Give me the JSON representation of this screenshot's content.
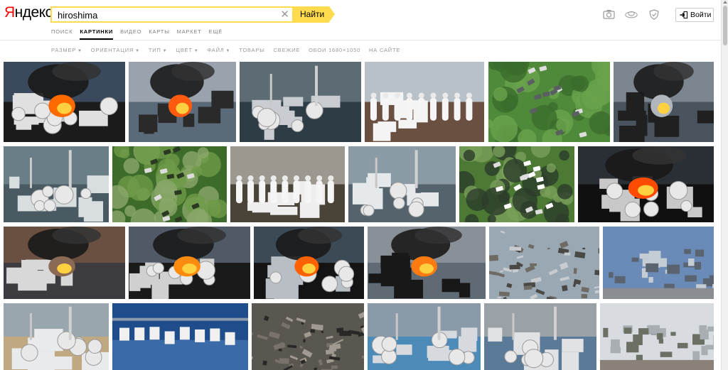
{
  "brand": {
    "logo_first": "Я",
    "logo_rest": "ндекс"
  },
  "search": {
    "query": "hiroshima",
    "button_label": "Найти"
  },
  "services": [
    {
      "label": "ПОИСК",
      "active": false
    },
    {
      "label": "КАРТИНКИ",
      "active": true
    },
    {
      "label": "ВИДЕО",
      "active": false
    },
    {
      "label": "КАРТЫ",
      "active": false
    },
    {
      "label": "МАРКЕТ",
      "active": false
    },
    {
      "label": "ЕЩЁ",
      "active": false
    }
  ],
  "filters": [
    {
      "label": "РАЗМЕР",
      "dropdown": true
    },
    {
      "label": "ОРИЕНТАЦИЯ",
      "dropdown": true
    },
    {
      "label": "ТИП",
      "dropdown": true
    },
    {
      "label": "ЦВЕТ",
      "dropdown": true
    },
    {
      "label": "ФАЙЛ",
      "dropdown": true
    },
    {
      "label": "ТОВАРЫ",
      "dropdown": false
    },
    {
      "label": "СВЕЖИЕ",
      "dropdown": false
    },
    {
      "label": "ОБОИ 1680×1050",
      "dropdown": false
    },
    {
      "label": "НА САЙТЕ",
      "dropdown": false
    }
  ],
  "header_icons": [
    "camera-icon",
    "cloud-disk-icon",
    "shield-icon"
  ],
  "login": {
    "label": "Войти",
    "icon": "login-arrow-icon"
  },
  "colors": {
    "accent": "#ffdb4d",
    "logo_red": "#ff0000"
  },
  "results": [
    {
      "subject": "fire",
      "palette": [
        "#3a4a5c",
        "#e0e0e0",
        "#ff6a00",
        "#1b1b1b"
      ]
    },
    {
      "subject": "smoke",
      "palette": [
        "#9aa3ad",
        "#2a2a2a",
        "#ff5a10",
        "#5a6a78"
      ]
    },
    {
      "subject": "plant",
      "palette": [
        "#5c6b74",
        "#c9ccd0",
        "#ffffff",
        "#2e3c46"
      ]
    },
    {
      "subject": "suits",
      "palette": [
        "#b8c0c8",
        "#f4f4f4",
        "#888f96",
        "#6a5040"
      ]
    },
    {
      "subject": "green",
      "palette": [
        "#4f8a3a",
        "#6aa24c",
        "#5a5f62",
        "#3b6b2c"
      ]
    },
    {
      "subject": "smoke",
      "palette": [
        "#7c8690",
        "#202020",
        "#b0b6bc",
        "#4a545e"
      ]
    },
    {
      "subject": "plant",
      "palette": [
        "#6a7e88",
        "#d8dde0",
        "#8a9aa4",
        "#4a5a62"
      ]
    },
    {
      "subject": "green",
      "palette": [
        "#3d6b2a",
        "#6e9a48",
        "#2a3a22",
        "#8aa86a"
      ]
    },
    {
      "subject": "suits",
      "palette": [
        "#9c9890",
        "#eeeeee",
        "#6e6456",
        "#4a4438"
      ]
    },
    {
      "subject": "plant",
      "palette": [
        "#8a9ba6",
        "#e6e9eb",
        "#a9b6be",
        "#55646c"
      ]
    },
    {
      "subject": "green",
      "palette": [
        "#4c7a34",
        "#2c3c2a",
        "#ffffff",
        "#7aa05a"
      ]
    },
    {
      "subject": "fire",
      "palette": [
        "#2a2f35",
        "#c8c8c8",
        "#ff4a00",
        "#101010"
      ]
    },
    {
      "subject": "smoke",
      "palette": [
        "#6a5040",
        "#d8d8d8",
        "#8a6a54",
        "#3c3c40"
      ]
    },
    {
      "subject": "fire",
      "palette": [
        "#505a66",
        "#d0d0d0",
        "#ff8a10",
        "#1a1a1a"
      ]
    },
    {
      "subject": "fire",
      "palette": [
        "#3c4a56",
        "#b8bec4",
        "#ff6000",
        "#141414"
      ]
    },
    {
      "subject": "smoke",
      "palette": [
        "#8a9098",
        "#181818",
        "#ff7a10",
        "#606a74"
      ]
    },
    {
      "subject": "debris",
      "palette": [
        "#9aa8b4",
        "#6e6a64",
        "#c8ccd0",
        "#4a4844"
      ]
    },
    {
      "subject": "city",
      "palette": [
        "#6a8ab8",
        "#c4ccd4",
        "#5a6470",
        "#8a8e92"
      ]
    },
    {
      "subject": "plant",
      "palette": [
        "#9aa6ae",
        "#e8eaec",
        "#6a7880",
        "#c0a880"
      ]
    },
    {
      "subject": "water",
      "palette": [
        "#1f4c8a",
        "#f0f0f0",
        "#3a6aa8",
        "#8a9aa8"
      ]
    },
    {
      "subject": "debris",
      "palette": [
        "#5a5650",
        "#2a2826",
        "#a09a90",
        "#78726a"
      ]
    },
    {
      "subject": "plant",
      "palette": [
        "#8a9aa8",
        "#d6dade",
        "#6a7682",
        "#4c8ab8"
      ]
    },
    {
      "subject": "plant",
      "palette": [
        "#9aa2a8",
        "#e0e2e4",
        "#7a8288",
        "#5a7a98"
      ]
    },
    {
      "subject": "city",
      "palette": [
        "#d8dce0",
        "#a8aeb2",
        "#6a7064",
        "#8a8278"
      ]
    }
  ]
}
